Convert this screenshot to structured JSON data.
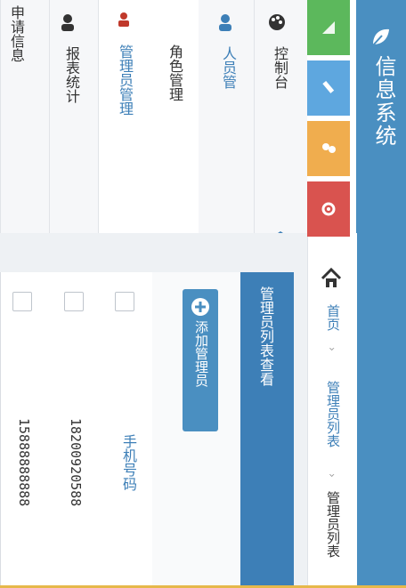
{
  "header": {
    "brand": "信息系统"
  },
  "breadcrumb": {
    "items": [
      "首页",
      "管理员列表",
      "管理员列表"
    ],
    "separator": "›"
  },
  "quick_buttons": [
    {
      "name": "chart",
      "color": "#5cb85c"
    },
    {
      "name": "pencil",
      "color": "#5ea7df"
    },
    {
      "name": "users",
      "color": "#f0ad4e"
    },
    {
      "name": "settings",
      "color": "#d9534f"
    }
  ],
  "sidebar": {
    "items": [
      {
        "label": "控制台",
        "icon": "palette-icon"
      },
      {
        "label": "人员管",
        "icon": "person-icon"
      },
      {
        "label": "角色管理",
        "icon": ""
      },
      {
        "label": "管理员管理",
        "icon": "admin-icon"
      },
      {
        "label": "报表统计",
        "icon": "person-icon"
      },
      {
        "label": "申请信息",
        "icon": ""
      }
    ]
  },
  "panel": {
    "title": "管理员列表查看",
    "add_button": "添加管理员"
  },
  "table": {
    "column_header": "手机号码",
    "rows": [
      "18200920588",
      "15888888888"
    ]
  },
  "colors": {
    "primary": "#3d7fb7",
    "titlebar": "#4a8fc1",
    "accent_line": "#e6b84a"
  }
}
